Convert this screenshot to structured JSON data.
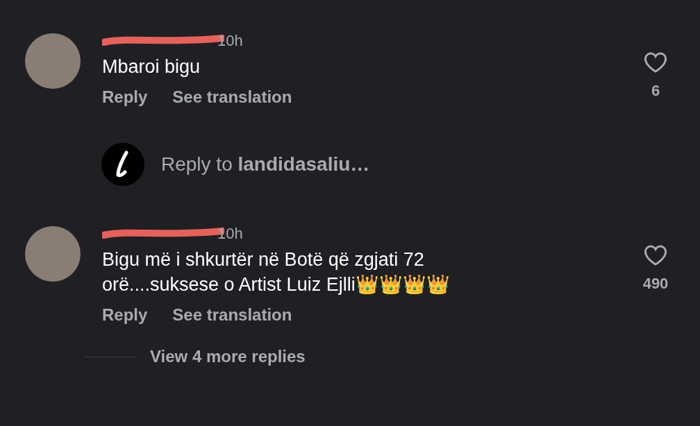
{
  "comments": [
    {
      "time": "10h",
      "text": "Mbaroi bigu",
      "actions": [
        "Reply",
        "See translation"
      ],
      "likes": "6",
      "liked": false
    },
    {
      "time": "10h",
      "text": "Bigu më i shkurtër në Botë që zgjati 72 orë....suksese o Artist Luiz Ejlli👑👑👑👑",
      "actions": [
        "Reply",
        "See translation"
      ],
      "likes": "490",
      "liked": false
    }
  ],
  "reply_composer": {
    "placeholder": "Reply to **landidasaliu…**"
  },
  "view_more": "View 4 more replies"
}
